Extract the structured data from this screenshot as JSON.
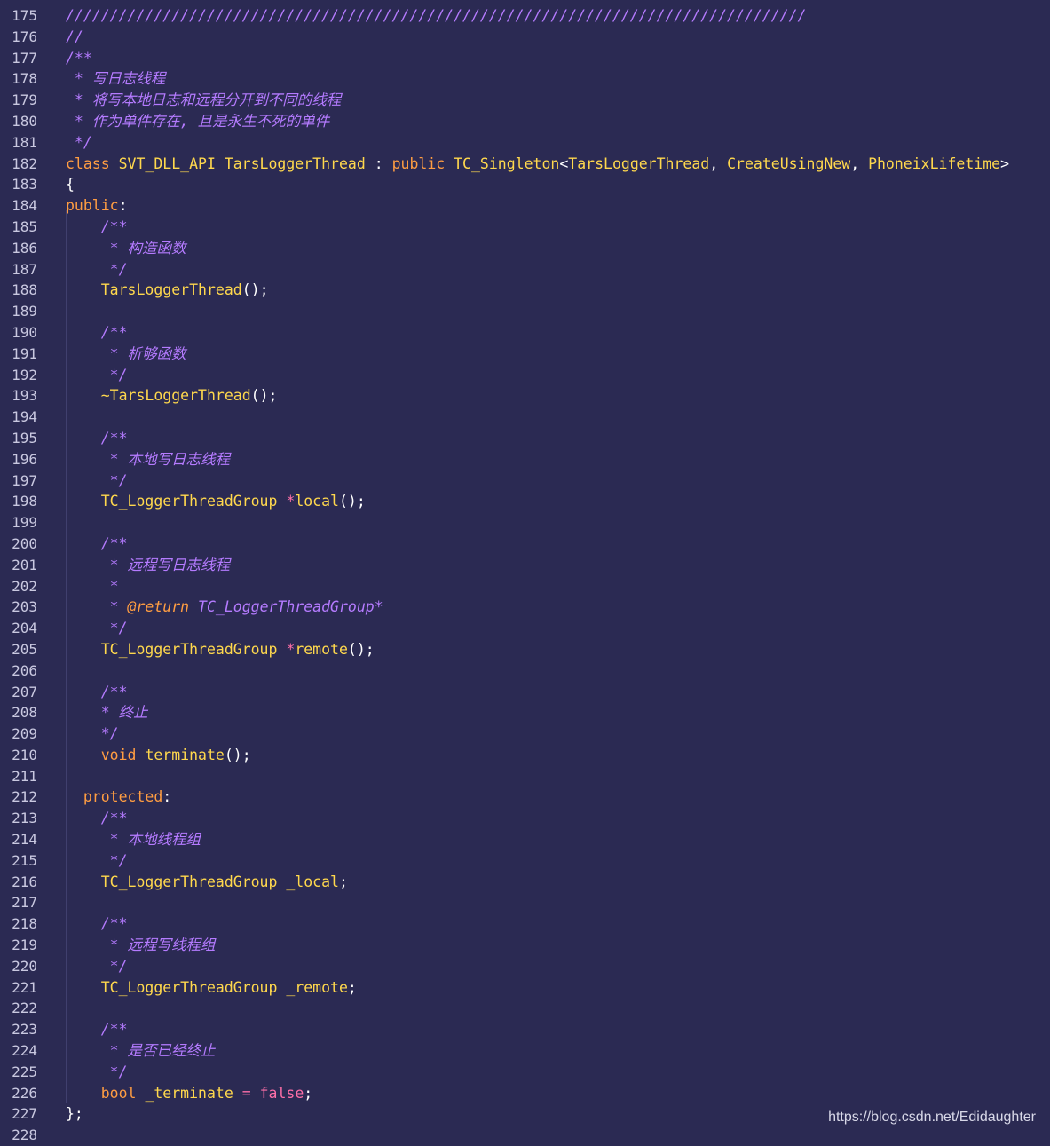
{
  "colors": {
    "background": "#2b2a53",
    "comment": "#b57bff",
    "keyword": "#ff9d42",
    "identifier": "#ffd84d",
    "operator": "#ff6fa8",
    "punctuation": "#ffffff",
    "line_number": "#c9c8e0"
  },
  "watermark": "https://blog.csdn.net/Edidaughter",
  "lines": [
    {
      "n": "175",
      "tokens": [
        {
          "c": "comment",
          "t": "////////////////////////////////////////////////////////////////////////////////////"
        }
      ]
    },
    {
      "n": "176",
      "tokens": [
        {
          "c": "comment",
          "t": "//"
        }
      ]
    },
    {
      "n": "177",
      "tokens": [
        {
          "c": "comment",
          "t": "/**"
        }
      ]
    },
    {
      "n": "178",
      "tokens": [
        {
          "c": "comment",
          "t": " * 写日志线程"
        }
      ]
    },
    {
      "n": "179",
      "tokens": [
        {
          "c": "comment",
          "t": " * 将写本地日志和远程分开到不同的线程"
        }
      ]
    },
    {
      "n": "180",
      "tokens": [
        {
          "c": "comment",
          "t": " * 作为单件存在, 且是永生不死的单件"
        }
      ]
    },
    {
      "n": "181",
      "tokens": [
        {
          "c": "comment",
          "t": " */"
        }
      ]
    },
    {
      "n": "182",
      "tokens": [
        {
          "c": "kw",
          "t": "class"
        },
        {
          "c": "punct",
          "t": " "
        },
        {
          "c": "type",
          "t": "SVT_DLL_API TarsLoggerThread"
        },
        {
          "c": "punct",
          "t": " : "
        },
        {
          "c": "kw",
          "t": "public"
        },
        {
          "c": "punct",
          "t": " "
        },
        {
          "c": "type",
          "t": "TC_Singleton"
        },
        {
          "c": "punct",
          "t": "<"
        },
        {
          "c": "type",
          "t": "TarsLoggerThread"
        },
        {
          "c": "punct",
          "t": ", "
        },
        {
          "c": "type",
          "t": "CreateUsingNew"
        },
        {
          "c": "punct",
          "t": ", "
        },
        {
          "c": "type",
          "t": "PhoneixLifetime"
        },
        {
          "c": "punct",
          "t": ">"
        }
      ]
    },
    {
      "n": "183",
      "tokens": [
        {
          "c": "punct",
          "t": "{"
        }
      ]
    },
    {
      "n": "184",
      "tokens": [
        {
          "c": "kw",
          "t": "public"
        },
        {
          "c": "punct",
          "t": ":"
        }
      ]
    },
    {
      "n": "185",
      "tokens": [
        {
          "c": "comment",
          "t": "    /**"
        }
      ]
    },
    {
      "n": "186",
      "tokens": [
        {
          "c": "comment",
          "t": "     * 构造函数"
        }
      ]
    },
    {
      "n": "187",
      "tokens": [
        {
          "c": "comment",
          "t": "     */"
        }
      ]
    },
    {
      "n": "188",
      "tokens": [
        {
          "c": "punct",
          "t": "    "
        },
        {
          "c": "type",
          "t": "TarsLoggerThread"
        },
        {
          "c": "punct",
          "t": "();"
        }
      ]
    },
    {
      "n": "189",
      "tokens": []
    },
    {
      "n": "190",
      "tokens": [
        {
          "c": "comment",
          "t": "    /**"
        }
      ]
    },
    {
      "n": "191",
      "tokens": [
        {
          "c": "comment",
          "t": "     * 析够函数"
        }
      ]
    },
    {
      "n": "192",
      "tokens": [
        {
          "c": "comment",
          "t": "     */"
        }
      ]
    },
    {
      "n": "193",
      "tokens": [
        {
          "c": "punct",
          "t": "    "
        },
        {
          "c": "type",
          "t": "~TarsLoggerThread"
        },
        {
          "c": "punct",
          "t": "();"
        }
      ]
    },
    {
      "n": "194",
      "tokens": []
    },
    {
      "n": "195",
      "tokens": [
        {
          "c": "comment",
          "t": "    /**"
        }
      ]
    },
    {
      "n": "196",
      "tokens": [
        {
          "c": "comment",
          "t": "     * 本地写日志线程"
        }
      ]
    },
    {
      "n": "197",
      "tokens": [
        {
          "c": "comment",
          "t": "     */"
        }
      ]
    },
    {
      "n": "198",
      "tokens": [
        {
          "c": "punct",
          "t": "    "
        },
        {
          "c": "type",
          "t": "TC_LoggerThreadGroup"
        },
        {
          "c": "punct",
          "t": " "
        },
        {
          "c": "op",
          "t": "*"
        },
        {
          "c": "type",
          "t": "local"
        },
        {
          "c": "punct",
          "t": "();"
        }
      ]
    },
    {
      "n": "199",
      "tokens": []
    },
    {
      "n": "200",
      "tokens": [
        {
          "c": "comment",
          "t": "    /**"
        }
      ]
    },
    {
      "n": "201",
      "tokens": [
        {
          "c": "comment",
          "t": "     * 远程写日志线程"
        }
      ]
    },
    {
      "n": "202",
      "tokens": [
        {
          "c": "comment",
          "t": "     *"
        }
      ]
    },
    {
      "n": "203",
      "tokens": [
        {
          "c": "comment",
          "t": "     * "
        },
        {
          "c": "tag",
          "t": "@return"
        },
        {
          "c": "comment",
          "t": " TC_LoggerThreadGroup*"
        }
      ]
    },
    {
      "n": "204",
      "tokens": [
        {
          "c": "comment",
          "t": "     */"
        }
      ]
    },
    {
      "n": "205",
      "tokens": [
        {
          "c": "punct",
          "t": "    "
        },
        {
          "c": "type",
          "t": "TC_LoggerThreadGroup"
        },
        {
          "c": "punct",
          "t": " "
        },
        {
          "c": "op",
          "t": "*"
        },
        {
          "c": "type",
          "t": "remote"
        },
        {
          "c": "punct",
          "t": "();"
        }
      ]
    },
    {
      "n": "206",
      "tokens": []
    },
    {
      "n": "207",
      "tokens": [
        {
          "c": "comment",
          "t": "    /**"
        }
      ]
    },
    {
      "n": "208",
      "tokens": [
        {
          "c": "comment",
          "t": "    * 终止"
        }
      ]
    },
    {
      "n": "209",
      "tokens": [
        {
          "c": "comment",
          "t": "    */"
        }
      ]
    },
    {
      "n": "210",
      "tokens": [
        {
          "c": "punct",
          "t": "    "
        },
        {
          "c": "kw",
          "t": "void"
        },
        {
          "c": "punct",
          "t": " "
        },
        {
          "c": "type",
          "t": "terminate"
        },
        {
          "c": "punct",
          "t": "();"
        }
      ]
    },
    {
      "n": "211",
      "tokens": []
    },
    {
      "n": "212",
      "tokens": [
        {
          "c": "punct",
          "t": "  "
        },
        {
          "c": "kw",
          "t": "protected"
        },
        {
          "c": "punct",
          "t": ":"
        }
      ]
    },
    {
      "n": "213",
      "tokens": [
        {
          "c": "comment",
          "t": "    /**"
        }
      ]
    },
    {
      "n": "214",
      "tokens": [
        {
          "c": "comment",
          "t": "     * 本地线程组"
        }
      ]
    },
    {
      "n": "215",
      "tokens": [
        {
          "c": "comment",
          "t": "     */"
        }
      ]
    },
    {
      "n": "216",
      "tokens": [
        {
          "c": "punct",
          "t": "    "
        },
        {
          "c": "type",
          "t": "TC_LoggerThreadGroup _local"
        },
        {
          "c": "punct",
          "t": ";"
        }
      ]
    },
    {
      "n": "217",
      "tokens": []
    },
    {
      "n": "218",
      "tokens": [
        {
          "c": "comment",
          "t": "    /**"
        }
      ]
    },
    {
      "n": "219",
      "tokens": [
        {
          "c": "comment",
          "t": "     * 远程写线程组"
        }
      ]
    },
    {
      "n": "220",
      "tokens": [
        {
          "c": "comment",
          "t": "     */"
        }
      ]
    },
    {
      "n": "221",
      "tokens": [
        {
          "c": "punct",
          "t": "    "
        },
        {
          "c": "type",
          "t": "TC_LoggerThreadGroup _remote"
        },
        {
          "c": "punct",
          "t": ";"
        }
      ]
    },
    {
      "n": "222",
      "tokens": []
    },
    {
      "n": "223",
      "tokens": [
        {
          "c": "comment",
          "t": "    /**"
        }
      ]
    },
    {
      "n": "224",
      "tokens": [
        {
          "c": "comment",
          "t": "     * 是否已经终止"
        }
      ]
    },
    {
      "n": "225",
      "tokens": [
        {
          "c": "comment",
          "t": "     */"
        }
      ]
    },
    {
      "n": "226",
      "tokens": [
        {
          "c": "punct",
          "t": "    "
        },
        {
          "c": "kw",
          "t": "bool"
        },
        {
          "c": "punct",
          "t": " "
        },
        {
          "c": "type",
          "t": "_terminate"
        },
        {
          "c": "punct",
          "t": " "
        },
        {
          "c": "op",
          "t": "="
        },
        {
          "c": "punct",
          "t": " "
        },
        {
          "c": "bool",
          "t": "false"
        },
        {
          "c": "punct",
          "t": ";"
        }
      ]
    },
    {
      "n": "227",
      "tokens": [
        {
          "c": "punct",
          "t": "};"
        }
      ]
    },
    {
      "n": "228",
      "tokens": []
    }
  ]
}
